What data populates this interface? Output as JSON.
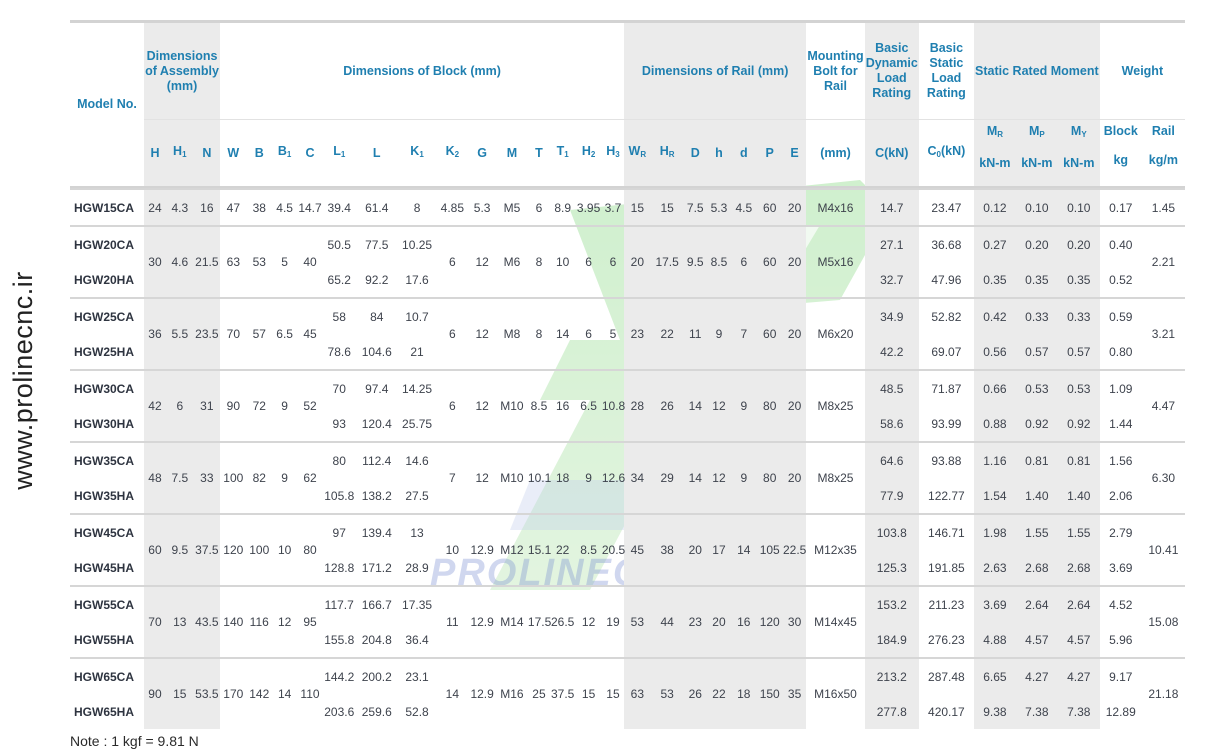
{
  "side_text": "www.prolinecnc.ir",
  "watermark_text": "PROLINECNC",
  "headers": {
    "model": "Model No.",
    "assembly": "Dimensions of Assembly (mm)",
    "block": "Dimensions of Block (mm)",
    "rail": "Dimensions of Rail (mm)",
    "mounting": "Mounting Bolt for Rail",
    "dynamic": "Basic Dynamic Load Rating",
    "static": "Basic Static Load Rating",
    "moment": "Static Rated Moment",
    "weight": "Weight",
    "block_w": "Block",
    "rail_w": "Rail",
    "sub": {
      "H": "H",
      "H1": "H",
      "N": "N",
      "W": "W",
      "B": "B",
      "B1": "B",
      "C": "C",
      "L1": "L",
      "L": "L",
      "K1": "K",
      "K2": "K",
      "G": "G",
      "M": "M",
      "T": "T",
      "T1": "T",
      "H2": "H",
      "H3": "H",
      "WR": "W",
      "HR": "H",
      "D": "D",
      "h": "h",
      "d": "d",
      "P": "P",
      "E": "E",
      "bolt_unit": "(mm)",
      "C_unit": "C(kN)",
      "C0": "C",
      "C0_unit": "(kN)",
      "MR": "M",
      "MP": "M",
      "MY": "M",
      "moment_unit": "kN-m",
      "block_unit": "kg",
      "rail_unit": "kg/m"
    },
    "subscripts": {
      "one": "1",
      "two": "2",
      "three": "3",
      "R": "R",
      "P": "P",
      "Y": "Y",
      "zero": "0"
    }
  },
  "rows": [
    {
      "model": "HGW15CA",
      "H": "24",
      "H1": "4.3",
      "N": "16",
      "W": "47",
      "B": "38",
      "B1": "4.5",
      "C": "14.7",
      "L1": "39.4",
      "L": "61.4",
      "K1": "8",
      "K2": "4.85",
      "G": "5.3",
      "M": "M5",
      "T": "6",
      "T1": "8.9",
      "H2": "3.95",
      "H3": "3.7",
      "WR": "15",
      "HR": "15",
      "D": "7.5",
      "h": "5.3",
      "d": "4.5",
      "P": "60",
      "E": "20",
      "bolt": "M4x16",
      "C0": "23.47",
      "MR": "0.12",
      "MP": "0.10",
      "MY": "0.10",
      "wb": "0.17",
      "wr": "1.45"
    },
    {
      "model": "HGW20CA",
      "H": "30",
      "H1": "4.6",
      "N": "21.5",
      "W": "63",
      "B": "53",
      "B1": "5",
      "Cc": "40",
      "L1": "50.5",
      "L": "77.5",
      "K1": "10.25",
      "K2": "6",
      "G": "12",
      "M": "M6",
      "T": "8",
      "T1": "10",
      "H2": "6",
      "H3": "6",
      "WR": "20",
      "HR": "17.5",
      "D": "9.5",
      "h": "8.5",
      "d": "6",
      "P": "60",
      "E": "20",
      "bolt": "M5x16",
      "C": "27.1",
      "C0": "36.68",
      "MR": "0.27",
      "MP": "0.20",
      "MY": "0.20",
      "wb": "0.40",
      "wr": "2.21"
    },
    {
      "model": "HGW20HA",
      "L1": "65.2",
      "L": "92.2",
      "K1": "17.6",
      "C": "32.7",
      "C0": "47.96",
      "MR": "0.35",
      "MP": "0.35",
      "MY": "0.35",
      "wb": "0.52"
    },
    {
      "model": "HGW25CA",
      "H": "36",
      "H1": "5.5",
      "N": "23.5",
      "W": "70",
      "B": "57",
      "B1": "6.5",
      "Cc": "45",
      "L1": "58",
      "L": "84",
      "K1": "10.7",
      "K2": "6",
      "G": "12",
      "M": "M8",
      "T": "8",
      "T1": "14",
      "H2": "6",
      "H3": "5",
      "WR": "23",
      "HR": "22",
      "D": "11",
      "h": "9",
      "d": "7",
      "P": "60",
      "E": "20",
      "bolt": "M6x20",
      "C": "34.9",
      "C0": "52.82",
      "MR": "0.42",
      "MP": "0.33",
      "MY": "0.33",
      "wb": "0.59",
      "wr": "3.21"
    },
    {
      "model": "HGW25HA",
      "L1": "78.6",
      "L": "104.6",
      "K1": "21",
      "C": "42.2",
      "C0": "69.07",
      "MR": "0.56",
      "MP": "0.57",
      "MY": "0.57",
      "wb": "0.80"
    },
    {
      "model": "HGW30CA",
      "H": "42",
      "H1": "6",
      "N": "31",
      "W": "90",
      "B": "72",
      "B1": "9",
      "Cc": "52",
      "L1": "70",
      "L": "97.4",
      "K1": "14.25",
      "K2": "6",
      "G": "12",
      "M": "M10",
      "T": "8.5",
      "T1": "16",
      "H2": "6.5",
      "H3": "10.8",
      "WR": "28",
      "HR": "26",
      "D": "14",
      "h": "12",
      "d": "9",
      "P": "80",
      "E": "20",
      "bolt": "M8x25",
      "C": "48.5",
      "C0": "71.87",
      "MR": "0.66",
      "MP": "0.53",
      "MY": "0.53",
      "wb": "1.09",
      "wr": "4.47"
    },
    {
      "model": "HGW30HA",
      "L1": "93",
      "L": "120.4",
      "K1": "25.75",
      "C": "58.6",
      "C0": "93.99",
      "MR": "0.88",
      "MP": "0.92",
      "MY": "0.92",
      "wb": "1.44"
    },
    {
      "model": "HGW35CA",
      "H": "48",
      "H1": "7.5",
      "N": "33",
      "W": "100",
      "B": "82",
      "B1": "9",
      "Cc": "62",
      "L1": "80",
      "L": "112.4",
      "K1": "14.6",
      "K2": "7",
      "G": "12",
      "M": "M10",
      "T": "10.1",
      "T1": "18",
      "H2": "9",
      "H3": "12.6",
      "WR": "34",
      "HR": "29",
      "D": "14",
      "h": "12",
      "d": "9",
      "P": "80",
      "E": "20",
      "bolt": "M8x25",
      "C": "64.6",
      "C0": "93.88",
      "MR": "1.16",
      "MP": "0.81",
      "MY": "0.81",
      "wb": "1.56",
      "wr": "6.30"
    },
    {
      "model": "HGW35HA",
      "L1": "105.8",
      "L": "138.2",
      "K1": "27.5",
      "C": "77.9",
      "C0": "122.77",
      "MR": "1.54",
      "MP": "1.40",
      "MY": "1.40",
      "wb": "2.06"
    },
    {
      "model": "HGW45CA",
      "H": "60",
      "H1": "9.5",
      "N": "37.5",
      "W": "120",
      "B": "100",
      "B1": "10",
      "Cc": "80",
      "L1": "97",
      "L": "139.4",
      "K1": "13",
      "K2": "10",
      "G": "12.9",
      "M": "M12",
      "T": "15.1",
      "T1": "22",
      "H2": "8.5",
      "H3": "20.5",
      "WR": "45",
      "HR": "38",
      "D": "20",
      "h": "17",
      "d": "14",
      "P": "105",
      "E": "22.5",
      "bolt": "M12x35",
      "C": "103.8",
      "C0": "146.71",
      "MR": "1.98",
      "MP": "1.55",
      "MY": "1.55",
      "wb": "2.79",
      "wr": "10.41"
    },
    {
      "model": "HGW45HA",
      "L1": "128.8",
      "L": "171.2",
      "K1": "28.9",
      "C": "125.3",
      "C0": "191.85",
      "MR": "2.63",
      "MP": "2.68",
      "MY": "2.68",
      "wb": "3.69"
    },
    {
      "model": "HGW55CA",
      "H": "70",
      "H1": "13",
      "N": "43.5",
      "W": "140",
      "B": "116",
      "B1": "12",
      "Cc": "95",
      "L1": "117.7",
      "L": "166.7",
      "K1": "17.35",
      "K2": "11",
      "G": "12.9",
      "M": "M14",
      "T": "17.5",
      "T1": "26.5",
      "H2": "12",
      "H3": "19",
      "WR": "53",
      "HR": "44",
      "D": "23",
      "h": "20",
      "d": "16",
      "P": "120",
      "E": "30",
      "bolt": "M14x45",
      "C": "153.2",
      "C0": "211.23",
      "MR": "3.69",
      "MP": "2.64",
      "MY": "2.64",
      "wb": "4.52",
      "wr": "15.08"
    },
    {
      "model": "HGW55HA",
      "L1": "155.8",
      "L": "204.8",
      "K1": "36.4",
      "C": "184.9",
      "C0": "276.23",
      "MR": "4.88",
      "MP": "4.57",
      "MY": "4.57",
      "wb": "5.96"
    },
    {
      "model": "HGW65CA",
      "H": "90",
      "H1": "15",
      "N": "53.5",
      "W": "170",
      "B": "142",
      "B1": "14",
      "Cc": "110",
      "L1": "144.2",
      "L": "200.2",
      "K1": "23.1",
      "K2": "14",
      "G": "12.9",
      "M": "M16",
      "T": "25",
      "T1": "37.5",
      "H2": "15",
      "H3": "15",
      "WR": "63",
      "HR": "53",
      "D": "26",
      "h": "22",
      "d": "18",
      "P": "150",
      "E": "35",
      "bolt": "M16x50",
      "C": "213.2",
      "C0": "287.48",
      "MR": "6.65",
      "MP": "4.27",
      "MY": "4.27",
      "wb": "9.17",
      "wr": "21.18"
    },
    {
      "model": "HGW65HA",
      "L1": "203.6",
      "L": "259.6",
      "K1": "52.8",
      "C": "277.8",
      "C0": "420.17",
      "MR": "9.38",
      "MP": "7.38",
      "MY": "7.38",
      "wb": "12.89"
    }
  ],
  "note": "Note : 1 kgf = 9.81 N"
}
